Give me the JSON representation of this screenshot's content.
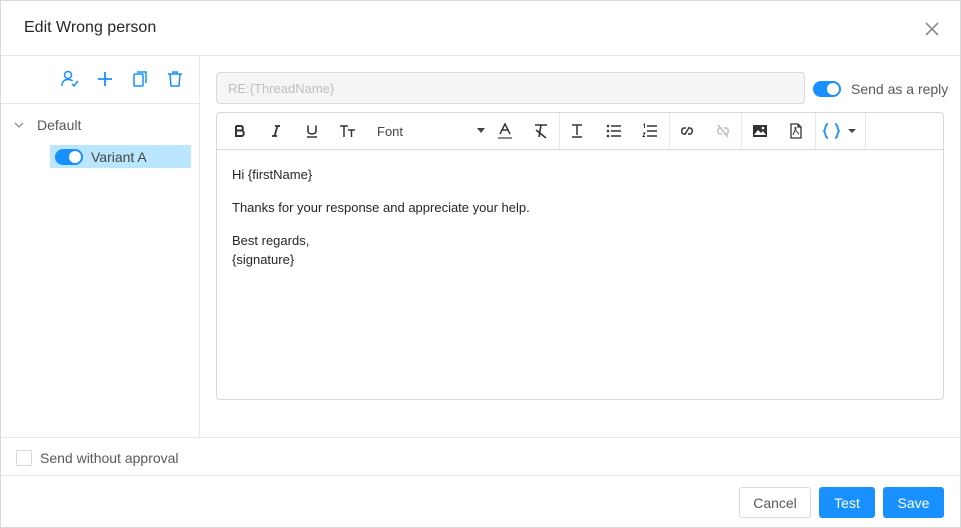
{
  "modal": {
    "title": "Edit Wrong person"
  },
  "sidebar": {
    "tools": [
      "assign-user-icon",
      "plus-icon",
      "copy-icon",
      "trash-icon"
    ],
    "tree": {
      "group_label": "Default",
      "variant_label": "Variant A",
      "variant_enabled": true
    }
  },
  "subject": {
    "value": "RE:{ThreadName}"
  },
  "reply": {
    "label": "Send as a reply",
    "enabled": true
  },
  "toolbar": {
    "font_label": "Font",
    "icons": [
      "bold-icon",
      "italic-icon",
      "underline-icon",
      "font-size-icon",
      "font-color-icon",
      "clear-format-icon",
      "text-height-icon",
      "bullet-list-icon",
      "numbered-list-icon",
      "link-icon",
      "unlink-icon",
      "image-icon",
      "pdf-icon",
      "variables-icon"
    ]
  },
  "body": {
    "greeting": "Hi {firstName}",
    "message": "Thanks for your response and appreciate your help.",
    "closing": "Best regards,",
    "signature": "{signature}"
  },
  "approval": {
    "label": "Send without approval",
    "checked": false
  },
  "buttons": {
    "cancel": "Cancel",
    "test": "Test",
    "save": "Save"
  },
  "colors": {
    "primary": "#1890ff",
    "selected_bg": "#bae7ff",
    "border": "#d9d9d9"
  }
}
